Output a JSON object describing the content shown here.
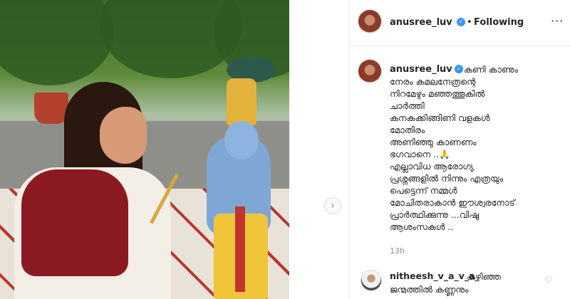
{
  "header": {
    "username": "anusree_luv",
    "separator": "•",
    "follow_status": "Following",
    "more_label": "···"
  },
  "caption": {
    "username": "anusree_luv",
    "text": "കണി കാണും\nനേരം കമലനേത്രന്റെ\nനിറമേഴും മഞ്ഞത്തൂകിൽ\nചാർത്തി\nകനകക്കിങ്ങിണി വളകൾ\nമോതിരം\nഅണിഞ്ഞു കാണണം\nഭഗവാനെ ..🙏\nഎല്ലാവിധ ആരോഗ്യ\nപ്രശ്നങ്ങളിൽ നിന്നും എത്രയും\nപെട്ടെന്ന് നമ്മൾ\nമോചിതരാകാൻ ഈശ്വരനോട്\nപ്രാർത്ഥിക്കുന്നു ...വിഷു\nആശംസകൾ ..",
    "time": "13h"
  },
  "comment": {
    "username": "nitheesh_v_a_v_a_",
    "text": "കഴിഞ്ഞ\nജന്മത്തിൽ കണ്ണനും"
  },
  "carousel": {
    "next_icon": "›"
  },
  "colors": {
    "verified": "#3897f0",
    "muted": "#8e8e8e",
    "text": "#262626"
  }
}
